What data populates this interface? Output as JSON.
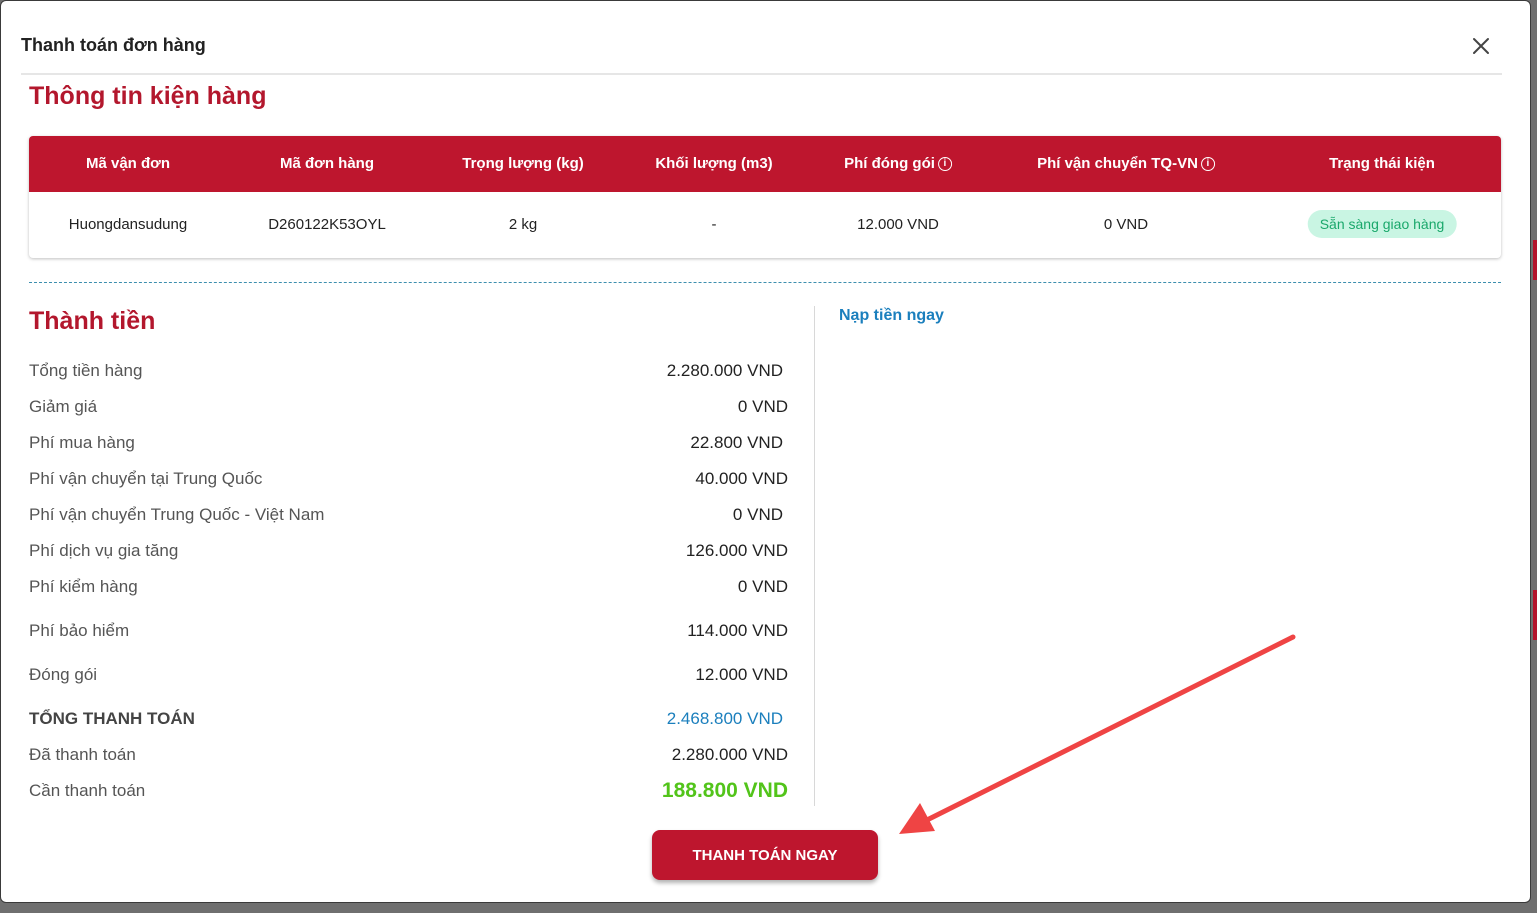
{
  "modal": {
    "title": "Thanh toán đơn hàng",
    "close_icon": "close-icon"
  },
  "package_section": {
    "title": "Thông tin kiện hàng",
    "columns": [
      "Mã vận đơn",
      "Mã đơn hàng",
      "Trọng lượng (kg)",
      "Khối lượng (m3)",
      "Phí đóng gói",
      "Phí vận chuyển TQ-VN",
      "Trạng thái kiện"
    ],
    "rows": [
      {
        "tracking_code": "Huongdansudung",
        "order_code": "D260122K53OYL",
        "weight": "2 kg",
        "volume": "-",
        "packing_fee": "12.000 VND",
        "shipping_fee": "0 VND",
        "status": "Sẵn sàng giao hàng"
      }
    ],
    "status_color": "#1aa86b",
    "header_color": "#be162e"
  },
  "totals_section": {
    "title": "Thành tiền",
    "items": [
      {
        "label": "Tổng tiền hàng",
        "value": "2.280.000 VND"
      },
      {
        "label": "Giảm giá",
        "value": "0 VND"
      },
      {
        "label": "Phí mua hàng",
        "value": "22.800 VND"
      },
      {
        "label": "Phí vận chuyển tại Trung Quốc",
        "value": "40.000 VND"
      },
      {
        "label": "Phí vận chuyển Trung Quốc - Việt Nam",
        "value": "0 VND"
      },
      {
        "label": "Phí dịch vụ gia tăng",
        "value": "126.000 VND"
      },
      {
        "label": "Phí kiểm hàng",
        "value": "0 VND"
      },
      {
        "label": "Phí bảo hiểm",
        "value": "114.000 VND"
      },
      {
        "label": "Đóng gói",
        "value": "12.000 VND"
      },
      {
        "label": "TỔNG THANH TOÁN",
        "value": "2.468.800 VND"
      },
      {
        "label": "Đã thanh toán",
        "value": "2.280.000 VND"
      },
      {
        "label": "Cần thanh toán",
        "value": "188.800 VND"
      }
    ],
    "total_color": "#1b7fbd",
    "due_color": "#52c41a"
  },
  "topup_link": "Nạp tiền ngay",
  "pay_button": "THANH TOÁN NGAY",
  "annotation": {
    "arrow_color": "#ef4444"
  }
}
